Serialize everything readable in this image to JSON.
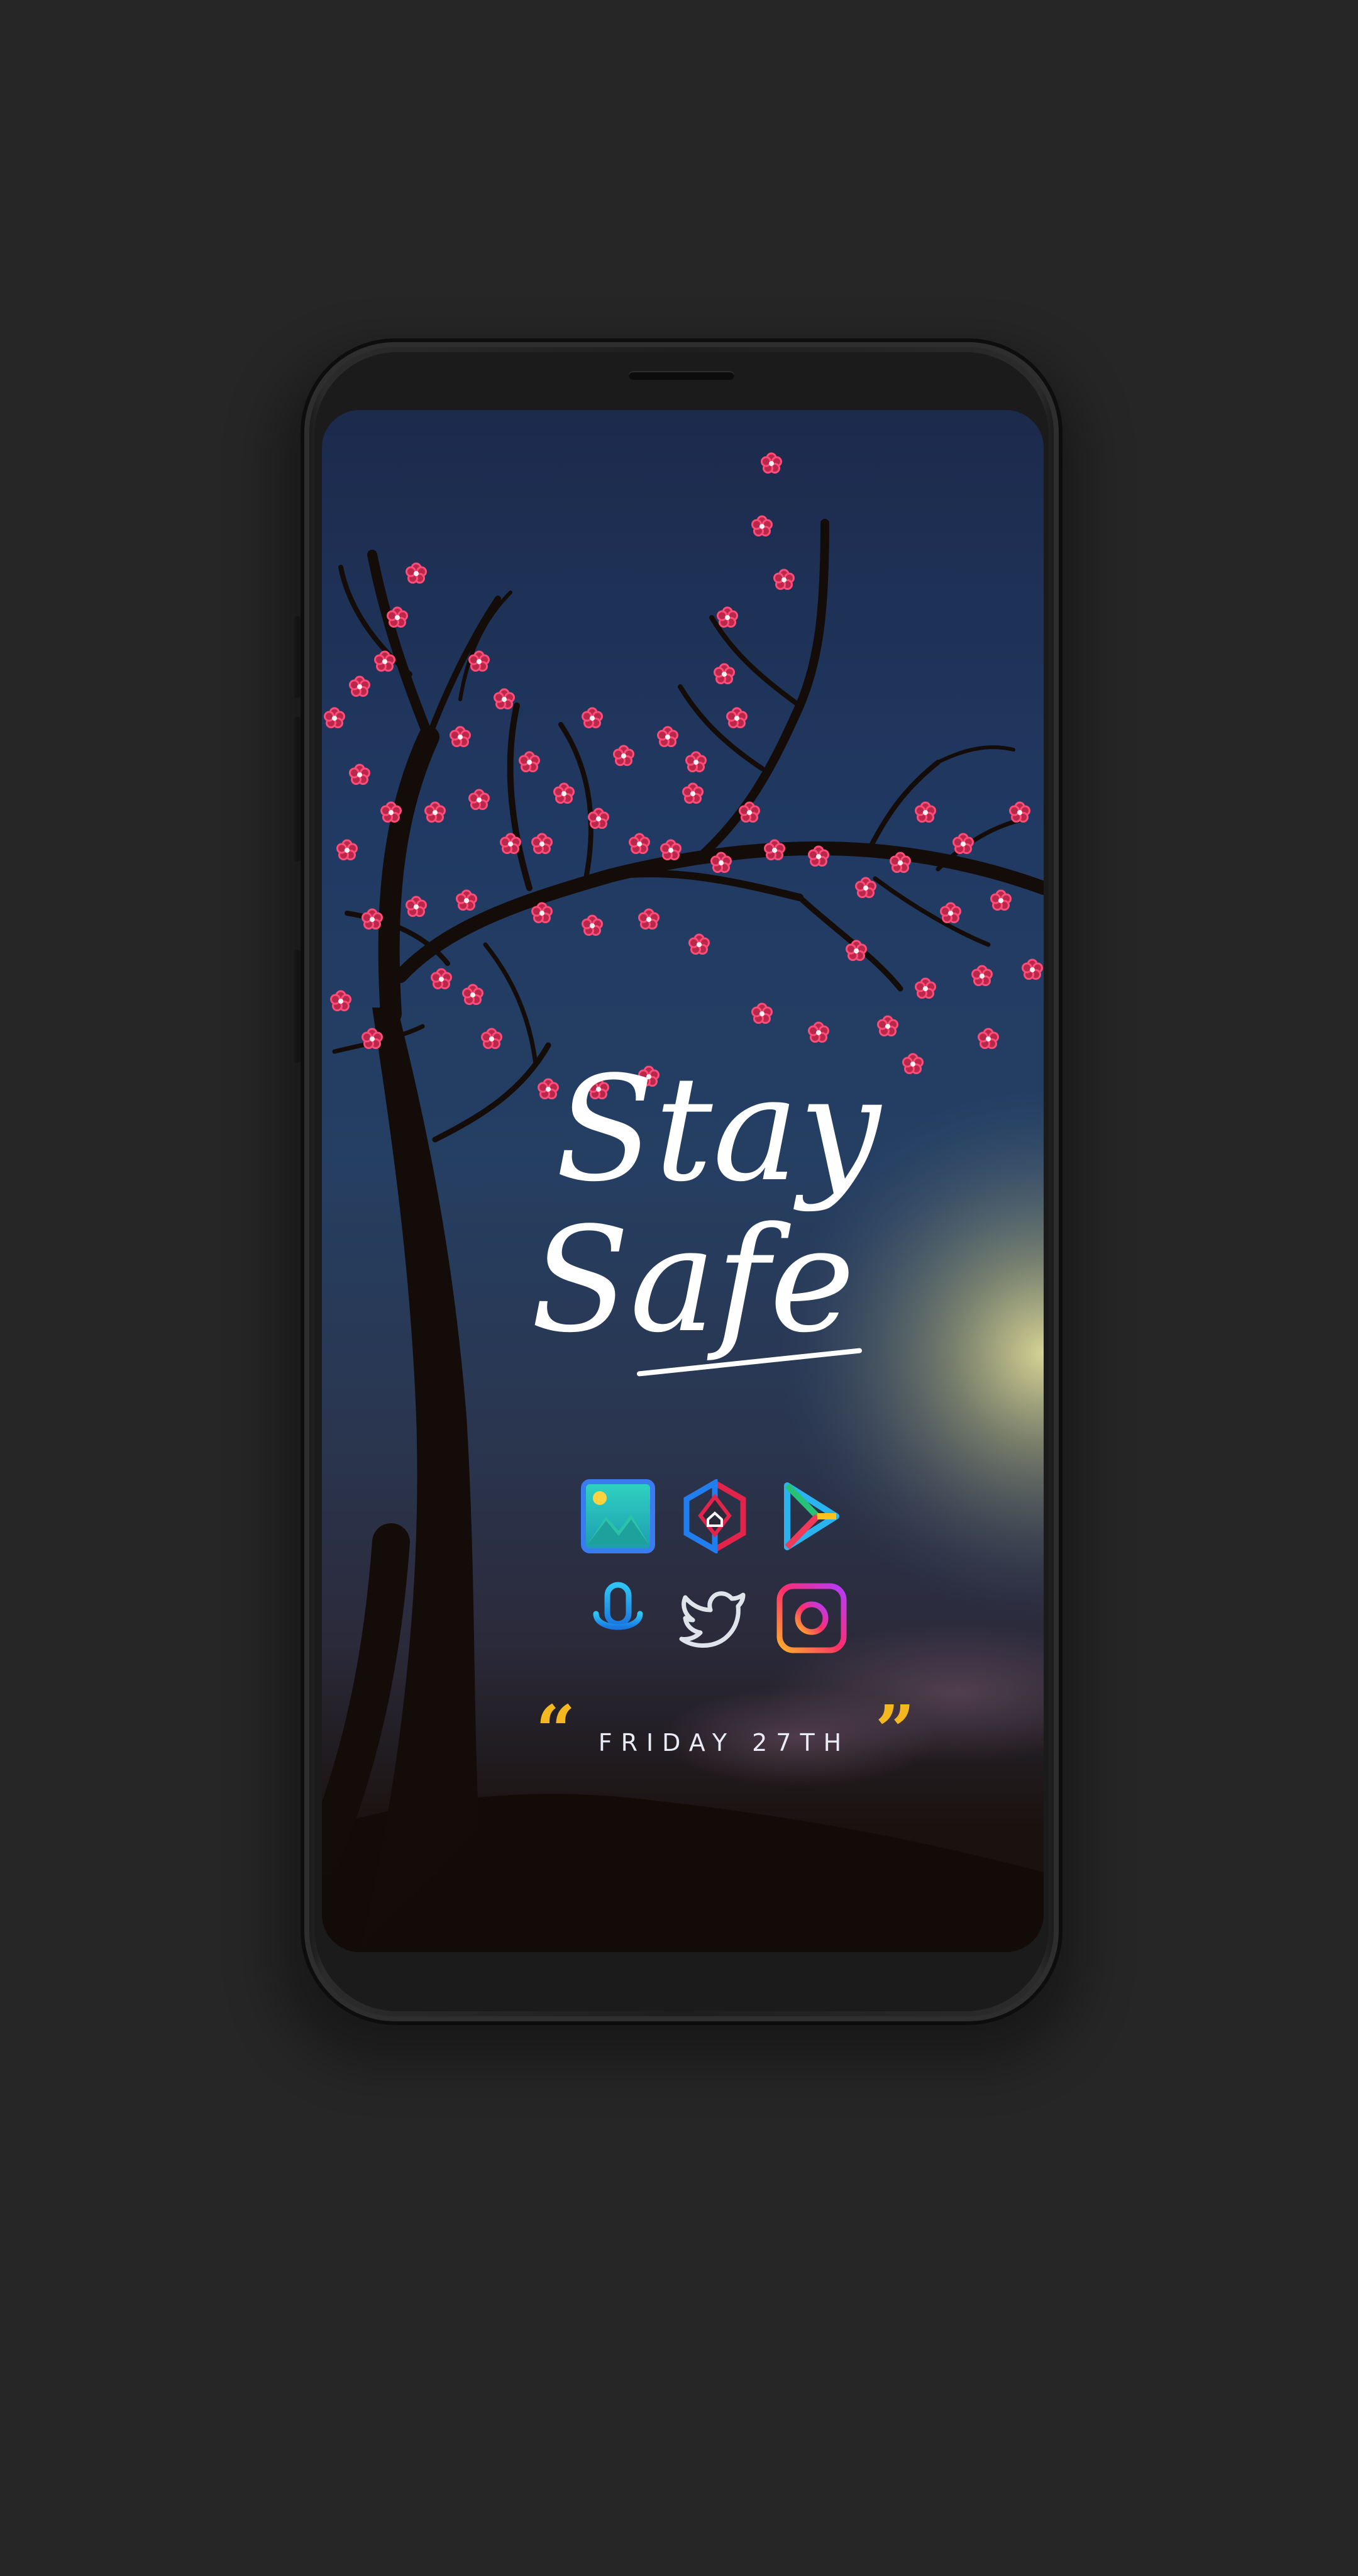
{
  "wallpaper": {
    "headline_line1": "Stay",
    "headline_line2": "Safe",
    "date_text": "FRIDAY 27TH",
    "open_quote": "“",
    "close_quote": "”"
  },
  "app_icons": [
    {
      "name": "gallery-icon",
      "icon": "image-landscape"
    },
    {
      "name": "nova-launcher-icon",
      "icon": "hexagon-home"
    },
    {
      "name": "play-store-icon",
      "icon": "play-triangle"
    },
    {
      "name": "voice-assistant-icon",
      "icon": "microphone"
    },
    {
      "name": "twitter-icon",
      "icon": "bird"
    },
    {
      "name": "instagram-icon",
      "icon": "camera-outline"
    }
  ],
  "colors": {
    "background": "#262626",
    "blossom": "#ff3f6b",
    "quote_accent": "#f3b81f",
    "glow": "#f6efa0",
    "text": "#ffffff"
  }
}
